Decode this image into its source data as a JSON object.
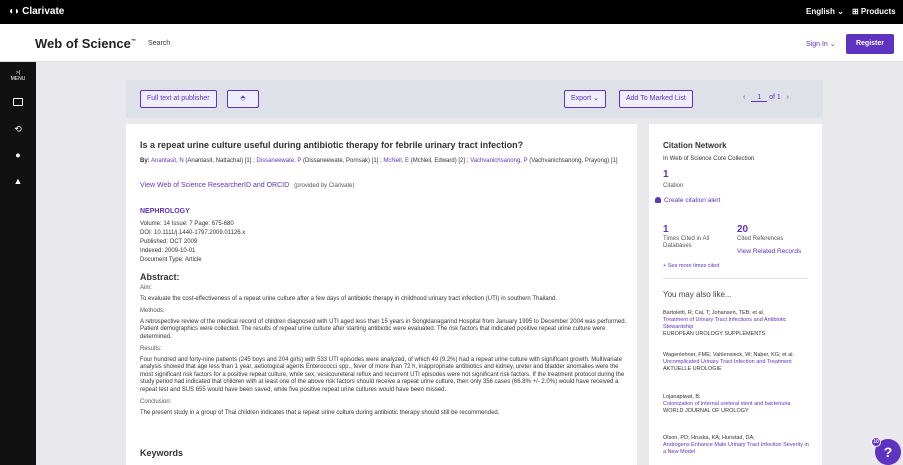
{
  "topbar": {
    "brand": "Clarivate",
    "language": "English ⌄",
    "products": "⊞ Products"
  },
  "header": {
    "product": "Web of Science",
    "tm": "™",
    "search": "Search",
    "signin": "Sign In ⌄",
    "register": "Register"
  },
  "rail": {
    "menu_label": "MENU"
  },
  "toolbar": {
    "fulltext": "Full text at publisher",
    "export": "Export ⌄",
    "add_marked": "Add To Marked List",
    "page_current": "1",
    "page_total": "of 1"
  },
  "record": {
    "title": "Is a repeat urine culture useful during antibiotic therapy for febrile urinary tract infection?",
    "by_label": "By:",
    "authors": [
      {
        "link": "Anantasit, N",
        "rest": " (Anantasit, Nattachai) [1] ; "
      },
      {
        "link": "Dissaneewate, P",
        "rest": " (Dissaneewate, Pornsak) [1] ; "
      },
      {
        "link": "McNeil, E",
        "rest": " (McNeil, Edward) [2] ; "
      },
      {
        "link": "Vachvanichsanong, P",
        "rest": " (Vachvanichsanong, Prayong) [1]"
      }
    ],
    "view_rid": "View Web of Science ResearcherID and ORCID",
    "provided": "(provided by Clarivate)",
    "journal": "NEPHROLOGY",
    "volume_line": "Volume: 14  Issue: 7  Page: 675-680",
    "doi": "DOI: 10.1111/j.1440-1797.2009.01126.x",
    "published": "Published: OCT 2009",
    "indexed": "Indexed: 2009-10-01",
    "doctype": "Document Type: Article",
    "abstract_heading": "Abstract:",
    "aim_label": "Aim:",
    "aim": "To evaluate the cost-effectiveness of a repeat urine culture after a few days of antibiotic therapy in childhood urinary tract infection (UTI) in southern Thailand.",
    "methods_label": "Methods:",
    "methods": "A retrospective review of the medical record of children diagnosed with UTI aged less than 15 years in Songklanagarind Hospital from January 1995 to December 2004 was performed. Patient demographics were collected. The results of repeat urine culture after starting antibiotic were evaluated. The risk factors that indicated positive repeat urine culture were determined.",
    "results_label": "Results:",
    "results": "Four hundred and forty-nine patients (245 boys and 204 girls) with 533 UTI episodes were analyzed, of which 49 (9.2%) had a repeat urine culture with significant growth. Multivariate analysis showed that age less than 1 year, aetiological agents Enterococci spp., fever of more than 72 h, inappropriate antibiotics and kidney, ureter and bladder anomalies were the most significant risk factors for a positive repeat culture, while sex, vesicoureteral reflux and recurrent UTI episodes were not significant risk factors. If the treatment protocol during the study period had indicated that children with at least one of the above risk factors should receive a repeat urine culture, then only 356 cases (66.8% +/- 2.0%) would have received a repeat test and SUS 655 would have been saved, while five positive repeat urine cultures would have been missed.",
    "conclusion_label": "Conclusion:",
    "conclusion": "The present study in a group of Thai children indicates that a repeat urine culture during antibiotic therapy should still be recommended.",
    "keywords_heading": "Keywords"
  },
  "citation": {
    "heading": "Citation Network",
    "collection": "In Web of Science Core Collection",
    "citations": "1",
    "citation_label": "Citation",
    "create_alert": "Create citation alert",
    "times_cited": "1",
    "times_cited_label": "Times Cited in All Databases",
    "cited_refs": "20",
    "cited_refs_label": "Cited References",
    "view_related": "View Related Records",
    "see_more": "+ See more times cited"
  },
  "also_like": {
    "heading": "You may also like...",
    "items": [
      {
        "authors": "Bartoletti, R; Cai, T; Johansen, TEB; et al.",
        "title": "Treatment of Urinary Tract Infections and Antibiotic Stewardship",
        "source": "EUROPEAN UROLOGY SUPPLEMENTS"
      },
      {
        "authors": "Wagenlehner, FME; Vahlensieck, W; Naber, KG; et al.",
        "title": "Uncomplicated Urinary Tract Infection and Treatment",
        "source": "AKTUELLE UROLOGIE"
      },
      {
        "authors": "Lojanapiwat, B;",
        "title": "Colonization of internal ureteral stent and bacteriuria",
        "source": "WORLD JOURNAL OF UROLOGY"
      },
      {
        "authors": "Olson, PD; Hruska, KA; Hunstad, DA;",
        "title": "Androgens Enhance Male Urinary Tract Infection Severity in a New Model",
        "source": ""
      }
    ]
  },
  "help": {
    "badge": "10",
    "label": "?"
  }
}
